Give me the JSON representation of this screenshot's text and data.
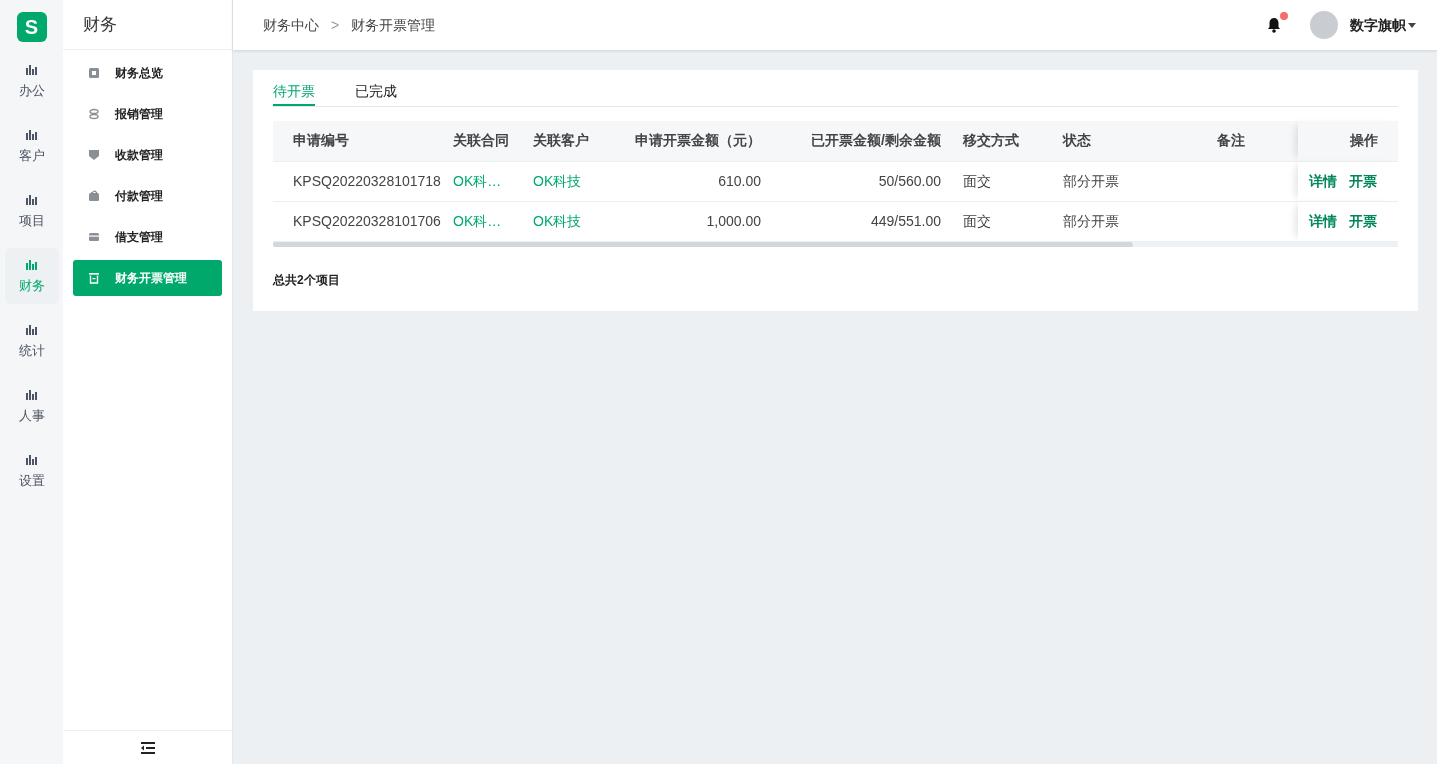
{
  "logo": {
    "letter": "S"
  },
  "rail": [
    {
      "label": "办公",
      "selected": false
    },
    {
      "label": "客户",
      "selected": false
    },
    {
      "label": "项目",
      "selected": false
    },
    {
      "label": "财务",
      "selected": true
    },
    {
      "label": "统计",
      "selected": false
    },
    {
      "label": "人事",
      "selected": false
    },
    {
      "label": "设置",
      "selected": false
    }
  ],
  "submenu": {
    "title": "财务",
    "items": [
      {
        "label": "财务总览",
        "selected": false
      },
      {
        "label": "报销管理",
        "selected": false
      },
      {
        "label": "收款管理",
        "selected": false
      },
      {
        "label": "付款管理",
        "selected": false
      },
      {
        "label": "借支管理",
        "selected": false
      },
      {
        "label": "财务开票管理",
        "selected": true
      }
    ]
  },
  "header": {
    "breadcrumb": [
      "财务中心",
      "财务开票管理"
    ],
    "separator": ">",
    "notification": true,
    "user": "数字旗帜"
  },
  "tabs": [
    {
      "label": "待开票",
      "selected": true
    },
    {
      "label": "已完成",
      "selected": false
    }
  ],
  "table": {
    "columns": [
      "申请编号",
      "关联合同",
      "关联客户",
      "申请开票金额（元）",
      "已开票金额/剩余金额",
      "移交方式",
      "状态",
      "备注",
      "操作"
    ],
    "rows": [
      {
        "cells": [
          "KPSQ20220328101718",
          "OK科…",
          "OK科技",
          "610.00",
          "50/560.00",
          "面交",
          "部分开票",
          ""
        ],
        "actions": [
          "详情",
          "开票"
        ]
      },
      {
        "cells": [
          "KPSQ20220328101706",
          "OK科…",
          "OK科技",
          "1,000.00",
          "449/551.00",
          "面交",
          "部分开票",
          ""
        ],
        "actions": [
          "详情",
          "开票"
        ]
      }
    ]
  },
  "total": "总共2个项目"
}
